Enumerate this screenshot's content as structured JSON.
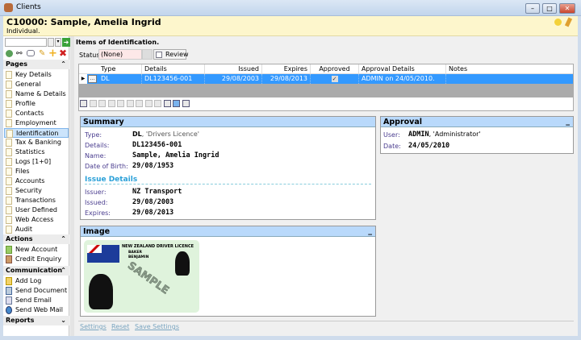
{
  "window": {
    "title": "Clients",
    "min": "–",
    "max": "□",
    "close": "✕"
  },
  "header": {
    "title": "C10000: Sample, Amelia Ingrid",
    "subtitle": "Individual."
  },
  "sidebar": {
    "pages_label": "Pages",
    "pages": [
      "Key Details",
      "General",
      "Name & Details",
      "Profile",
      "Contacts",
      "Employment",
      "Identification",
      "Tax & Banking",
      "Statistics",
      "Logs [1+0]",
      "Files",
      "Accounts",
      "Security",
      "Transactions",
      "User Defined",
      "Web Access",
      "Audit"
    ],
    "selected": "Identification",
    "actions_label": "Actions",
    "actions": [
      "New Account",
      "Credit Enquiry"
    ],
    "communication_label": "Communication",
    "communication": [
      "Add Log",
      "Send Document",
      "Send Email",
      "Send Web Mail"
    ],
    "reports_label": "Reports"
  },
  "main": {
    "title": "Items of Identification.",
    "status_label": "Status:",
    "status_value": "(None)",
    "review_label": "Review",
    "columns": [
      "Type",
      "Details",
      "Issued",
      "Expires",
      "Approved",
      "Approval Details",
      "Notes"
    ],
    "rows": [
      {
        "type": "DL",
        "details": "DL123456-001",
        "issued": "29/08/2003",
        "expires": "29/08/2013",
        "approved": "✓",
        "approval_details": "ADMIN on 24/05/2010.",
        "notes": ""
      }
    ]
  },
  "summary": {
    "title": "Summary",
    "type_label": "Type:",
    "type_code": "DL",
    "type_desc": ", 'Drivers Licence'",
    "details_label": "Details:",
    "details": "DL123456-001",
    "name_label": "Name:",
    "name": "Sample, Amelia Ingrid",
    "dob_label": "Date of Birth:",
    "dob": "29/08/1953",
    "issue_heading": "Issue Details",
    "issuer_label": "Issuer:",
    "issuer": "NZ Transport",
    "issued_label": "Issued:",
    "issued": "29/08/2003",
    "expires_label": "Expires:",
    "expires": "29/08/2013"
  },
  "approval": {
    "title": "Approval",
    "user_label": "User:",
    "user": "ADMIN",
    "user_desc": ", 'Administrator'",
    "date_label": "Date:",
    "date": "24/05/2010"
  },
  "image": {
    "title": "Image",
    "card_title": "NEW ZEALAND DRIVER LICENCE",
    "card_surname": "BAKER",
    "card_given": "BENJAMIN",
    "watermark": "SAMPLE"
  },
  "footer": {
    "settings": "Settings",
    "reset": "Reset",
    "save": "Save Settings"
  }
}
